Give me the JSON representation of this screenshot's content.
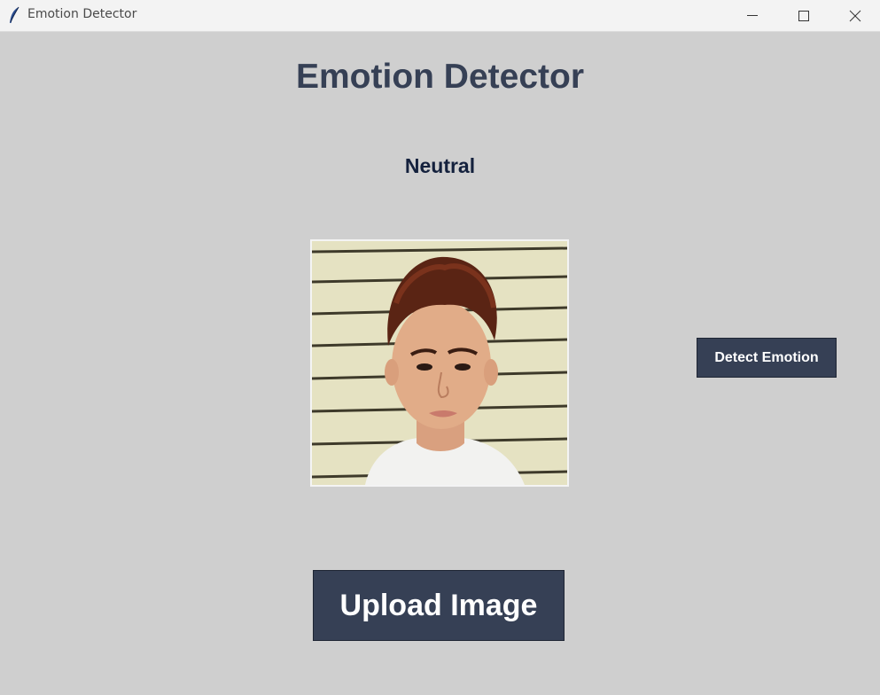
{
  "window": {
    "title": "Emotion Detector",
    "app_icon": "feather-icon",
    "controls": [
      "minimize-icon",
      "maximize-icon",
      "close-icon"
    ]
  },
  "main": {
    "heading": "Emotion Detector",
    "detected_emotion": "Neutral",
    "image_preview": {
      "description_icon": "face-photo"
    },
    "detect_button": "Detect Emotion",
    "upload_button": "Upload Image"
  },
  "colors": {
    "background": "#cfcfcf",
    "button": "#364055",
    "heading": "#364055",
    "result_text": "#14213d"
  }
}
